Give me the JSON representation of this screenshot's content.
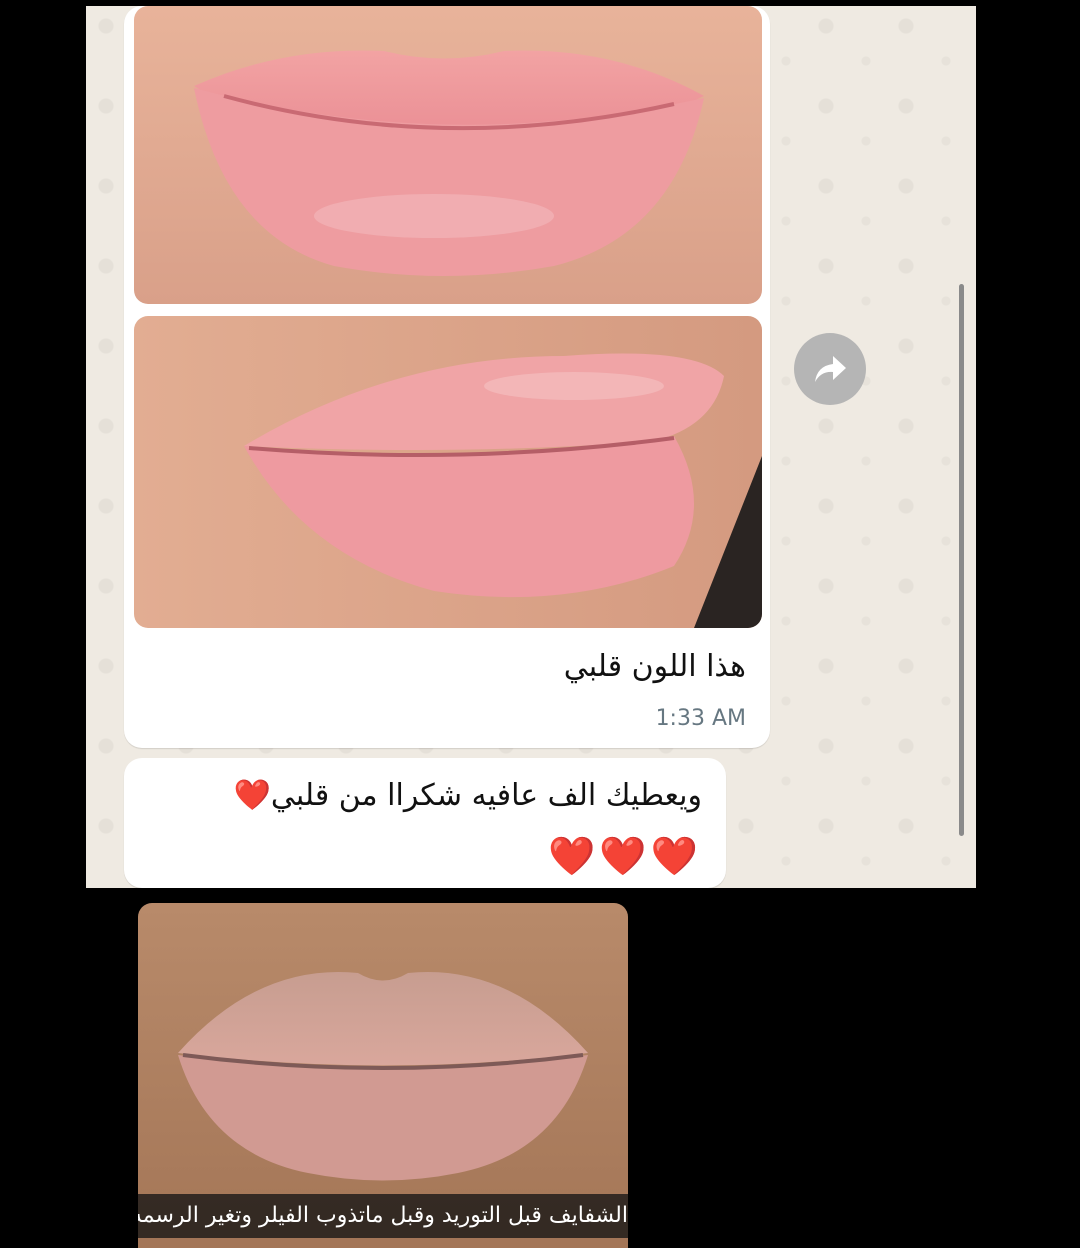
{
  "chat": {
    "message_photo_caption": "هذا اللون قلبي",
    "message_time": "1:33 AM",
    "reply_text": "ويعطيك الف عافيه شكراا من قلبي❤️",
    "reply_hearts": "❤️❤️❤️",
    "forward_icon": "forward-arrow-icon"
  },
  "before_section": {
    "caption": "الشفايف قبل التوريد وقبل ماتذوب الفيلر وتغير الرسمه"
  },
  "colors": {
    "chat_background": "#efeae2",
    "bubble": "#ffffff",
    "timestamp": "#667781",
    "page_background": "#000000"
  }
}
